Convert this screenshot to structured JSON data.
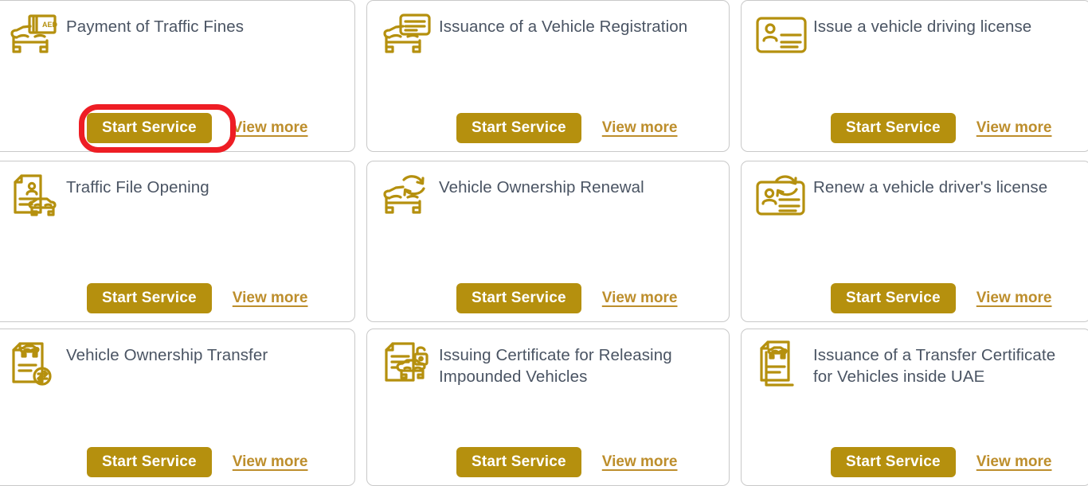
{
  "theme": {
    "gold": "#b5900e",
    "gold_link": "#bd8e2c",
    "icon_gold": "#b5900e",
    "title_text": "#4a5463",
    "card_border": "#c9c9c9",
    "highlight_red": "#ee1d24",
    "card_background": "#ffffff"
  },
  "labels": {
    "start_service": "Start Service",
    "view_more": "View more"
  },
  "annotation": {
    "type": "red-highlight-ring",
    "target": "start-service-button-payment-of-traffic-fines",
    "color": "#ee1d24"
  },
  "grid": {
    "columns": 3,
    "rows": 3,
    "cards": [
      {
        "title": "Payment of Traffic Fines",
        "icon": "car-with-aed-banknote-icon",
        "start_label": "Start Service",
        "view_label": "View more",
        "highlighted": true
      },
      {
        "title": "Issuance of a Vehicle Registration",
        "icon": "car-with-registration-card-icon",
        "start_label": "Start Service",
        "view_label": "View more",
        "highlighted": false
      },
      {
        "title": "Issue a vehicle driving license",
        "icon": "id-license-card-icon",
        "start_label": "Start Service",
        "view_label": "View more",
        "highlighted": false
      },
      {
        "title": "Traffic File Opening",
        "icon": "document-with-person-and-car-icon",
        "start_label": "Start Service",
        "view_label": "View more",
        "highlighted": false
      },
      {
        "title": "Vehicle Ownership Renewal",
        "icon": "car-with-renew-arrows-icon",
        "start_label": "Start Service",
        "view_label": "View more",
        "highlighted": false
      },
      {
        "title": "Renew a vehicle driver's license",
        "icon": "license-card-with-renew-arrows-icon",
        "start_label": "Start Service",
        "view_label": "View more",
        "highlighted": false
      },
      {
        "title": "Vehicle Ownership Transfer",
        "icon": "document-with-car-and-transfer-arrows-icon",
        "start_label": "Start Service",
        "view_label": "View more",
        "highlighted": false
      },
      {
        "title": "Issuing Certificate for Releasing\nImpounded Vehicles",
        "icon": "document-with-car-and-open-lock-icon",
        "start_label": "Start Service",
        "view_label": "View more",
        "highlighted": false
      },
      {
        "title": "Issuance of a Transfer Certificate\nfor Vehicles inside UAE",
        "icon": "stacked-documents-with-car-icon",
        "start_label": "Start Service",
        "view_label": "View more",
        "highlighted": false
      }
    ]
  }
}
